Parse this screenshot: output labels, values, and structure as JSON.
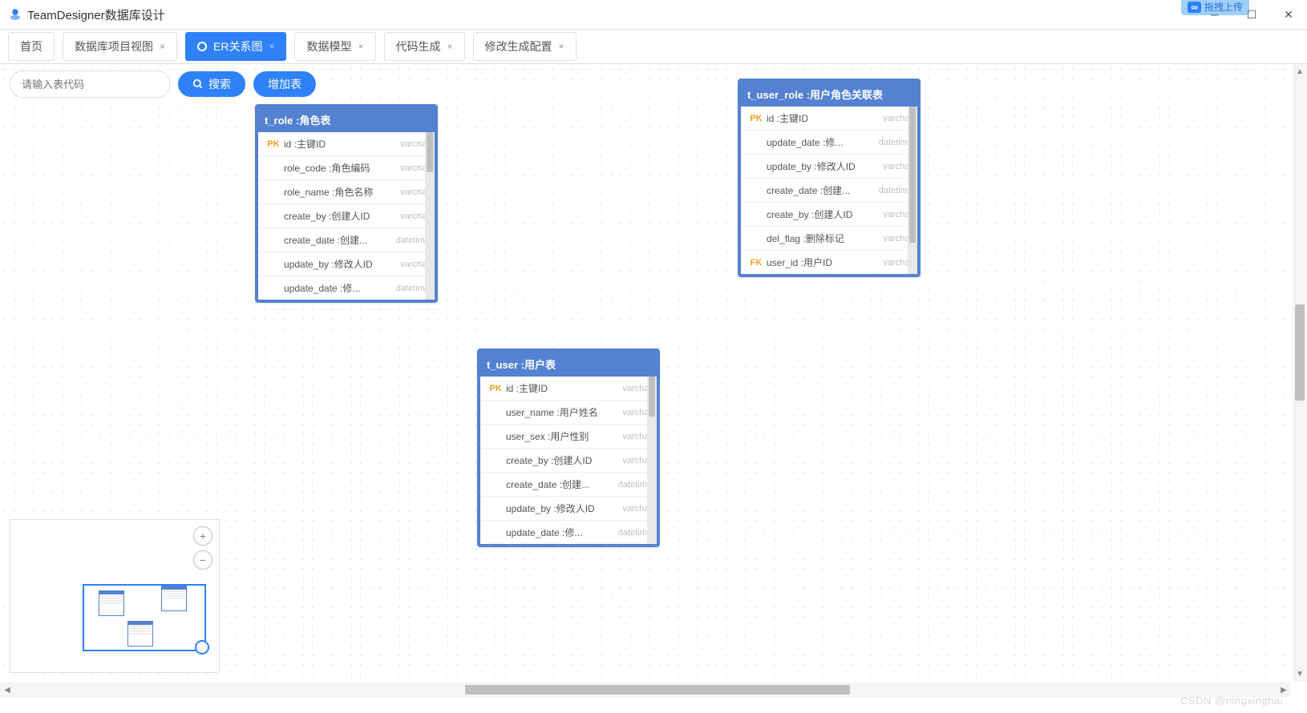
{
  "app": {
    "title": "TeamDesigner数据库设计"
  },
  "overlay": {
    "label": "拖拽上传",
    "icon": "∞"
  },
  "tabs": [
    {
      "label": "首页",
      "closable": false,
      "active": false
    },
    {
      "label": "数据库项目视图",
      "closable": true,
      "active": false
    },
    {
      "label": "ER关系图",
      "closable": true,
      "active": true
    },
    {
      "label": "数据模型",
      "closable": true,
      "active": false
    },
    {
      "label": "代码生成",
      "closable": true,
      "active": false
    },
    {
      "label": "修改生成配置",
      "closable": true,
      "active": false
    }
  ],
  "toolbar": {
    "search_placeholder": "请输入表代码",
    "search_btn": "搜索",
    "add_btn": "增加表"
  },
  "entities": {
    "t_role": {
      "title": "t_role :角色表",
      "rows": [
        {
          "key": "PK",
          "name": "id :主键ID",
          "type": "varchar"
        },
        {
          "key": "",
          "name": "role_code :角色编码",
          "type": "varchar"
        },
        {
          "key": "",
          "name": "role_name :角色名称",
          "type": "varchar"
        },
        {
          "key": "",
          "name": "create_by :创建人ID",
          "type": "varchar"
        },
        {
          "key": "",
          "name": "create_date :创建...",
          "type": "datetime"
        },
        {
          "key": "",
          "name": "update_by :修改人ID",
          "type": "varchar"
        },
        {
          "key": "",
          "name": "update_date :修...",
          "type": "datetime"
        }
      ]
    },
    "t_user": {
      "title": "t_user :用户表",
      "rows": [
        {
          "key": "PK",
          "name": "id :主键ID",
          "type": "varchar"
        },
        {
          "key": "",
          "name": "user_name :用户姓名",
          "type": "varchar"
        },
        {
          "key": "",
          "name": "user_sex :用户性别",
          "type": "varchar"
        },
        {
          "key": "",
          "name": "create_by :创建人ID",
          "type": "varchar"
        },
        {
          "key": "",
          "name": "create_date :创建...",
          "type": "datetime"
        },
        {
          "key": "",
          "name": "update_by :修改人ID",
          "type": "varchar"
        },
        {
          "key": "",
          "name": "update_date :修...",
          "type": "datetime"
        }
      ]
    },
    "t_user_role": {
      "title": "t_user_role :用户角色关联表",
      "rows": [
        {
          "key": "PK",
          "name": "id :主键ID",
          "type": "varchar"
        },
        {
          "key": "",
          "name": "update_date :修...",
          "type": "datetime"
        },
        {
          "key": "",
          "name": "update_by :修改人ID",
          "type": "varchar"
        },
        {
          "key": "",
          "name": "create_date :创建...",
          "type": "datetime"
        },
        {
          "key": "",
          "name": "create_by :创建人ID",
          "type": "varchar"
        },
        {
          "key": "",
          "name": "del_flag :删除标记",
          "type": "varchar"
        },
        {
          "key": "FK",
          "name": "user_id :用户ID",
          "type": "varchar"
        }
      ]
    }
  },
  "watermark": "CSDN @ningxinghai"
}
